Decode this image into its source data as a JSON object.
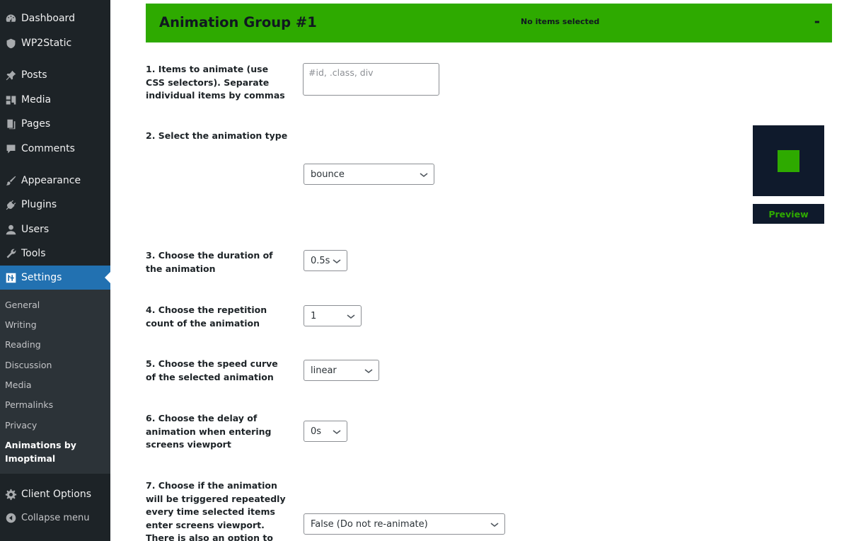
{
  "sidebar": {
    "items": [
      {
        "label": "Dashboard",
        "icon": "dashboard-icon"
      },
      {
        "label": "WP2Static",
        "icon": "shield-icon"
      },
      {
        "label": "Posts",
        "icon": "pin-icon"
      },
      {
        "label": "Media",
        "icon": "media-icon"
      },
      {
        "label": "Pages",
        "icon": "pages-icon"
      },
      {
        "label": "Comments",
        "icon": "comment-icon"
      },
      {
        "label": "Appearance",
        "icon": "brush-icon"
      },
      {
        "label": "Plugins",
        "icon": "plugin-icon"
      },
      {
        "label": "Users",
        "icon": "user-icon"
      },
      {
        "label": "Tools",
        "icon": "wrench-icon"
      },
      {
        "label": "Settings",
        "icon": "settings-icon"
      }
    ],
    "submenu": [
      "General",
      "Writing",
      "Reading",
      "Discussion",
      "Media",
      "Permalinks",
      "Privacy"
    ],
    "submenu_current": "Animations by Imoptimal",
    "client_options": "Client Options",
    "collapse": "Collapse menu"
  },
  "group": {
    "title": "Animation Group #1",
    "status": "No items selected",
    "toggle": "-"
  },
  "form": {
    "q1": "1. Items to animate (use CSS selectors). Separate individual items by commas",
    "q1_placeholder": "#id, .class, div",
    "q2": "2. Select the animation type",
    "q2_value": "bounce",
    "q3": "3. Choose the duration of the animation",
    "q3_value": "0.5s",
    "q4": "4. Choose the repetition count of the animation",
    "q4_value": "1",
    "q5": "5. Choose the speed curve of the selected animation",
    "q5_value": "linear",
    "q6": "6. Choose the delay of animation when entering screens viewport",
    "q6_value": "0s",
    "q7": "7. Choose if the animation will be triggered repeatedly every time selected items enter screens viewport. There is also an option to",
    "q7_value": "False (Do not re-animate)"
  },
  "preview": {
    "button": "Preview"
  },
  "colors": {
    "accent_green": "#2eaa00",
    "sidebar_bg": "#1d2327",
    "active_blue": "#2271b1",
    "preview_bg": "#0f1a2c"
  }
}
